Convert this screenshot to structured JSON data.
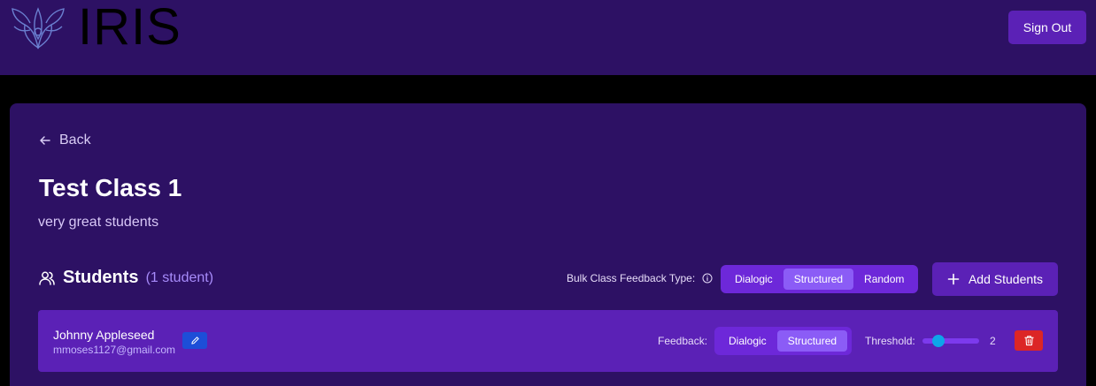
{
  "header": {
    "brand": "IRIS",
    "sign_out_label": "Sign Out"
  },
  "page": {
    "back_label": "Back",
    "title": "Test Class 1",
    "description": "very great students"
  },
  "students": {
    "heading": "Students",
    "count_label": "(1 student)",
    "bulk_label": "Bulk Class Feedback Type:",
    "bulk_options": [
      "Dialogic",
      "Structured",
      "Random"
    ],
    "bulk_selected": "Structured",
    "add_label": "Add Students",
    "list": [
      {
        "name": "Johnny Appleseed",
        "email": "mmoses1127@gmail.com",
        "feedback_label": "Feedback:",
        "feedback_options": [
          "Dialogic",
          "Structured"
        ],
        "feedback_selected": "Structured",
        "threshold_label": "Threshold:",
        "threshold_value": "2"
      }
    ]
  },
  "icons": {
    "logo": "iris-flower-logo",
    "back": "arrow-left-icon",
    "students": "users-icon",
    "info": "info-icon",
    "add": "plus-icon",
    "edit": "pencil-icon",
    "delete": "trash-icon"
  },
  "colors": {
    "header_bg": "#2d1164",
    "card_bg": "#2d1164",
    "accent": "#5b21b6",
    "segment_bg": "#6d28d9",
    "segment_active": "#8b5cf6",
    "edit": "#1d4ed8",
    "delete": "#dc2626",
    "slider_thumb": "#0ea5e9"
  }
}
